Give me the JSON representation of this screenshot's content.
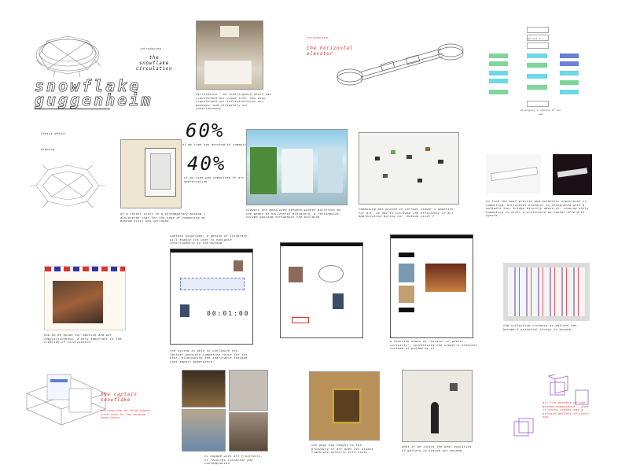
{
  "header": {
    "introducing_1": "introducing",
    "snowflake_circulation": "the snowflake circulation",
    "introducing_2": "introducing",
    "horizontal_elevator": "the horizontal elevator"
  },
  "title": {
    "line1": "snowflake",
    "line2": "guggenheim",
    "detail1": "thesis detail",
    "detail2": "drawing"
  },
  "stats": {
    "pct1": "60%",
    "cap1": "of my time was devoted to commuting",
    "pct2": "40%",
    "cap2": "of my time was committed to art appreciation"
  },
  "captions": {
    "circulation": "circulation - an intelligence which has transformed our urban life. has also transformed our infrastructures our museums. and ultimately our consciousness",
    "kiosk": "on a recent visit to a contemporary museum i discovered that for the sake of commuting my museum visit was shrinked",
    "atrium": "viewers are mobilized between pocket galleries by the means of horizontal elevators, a rectangular volume passing throughout the building",
    "gallery": "commuting has proved to corrupt viewer's appetite for art. so how to increase the efficiency in art appreciation during our 'museum visit'?",
    "elevator": "to find the most precise and authentic experience in commuting. horizontal elevator is integrated with a walkable tour bridge directly above it. viewing while commuting is still a preference we cannot afford to ignore.",
    "captain_intro": "captain snowflake, a genius of itinerary, will enable its user to navigate intelligently in the museum",
    "postcard": "how do we guide our emotion and our inquisitiveness, a very important in the creation of civilisation",
    "configure": "the system is able to configure the fastest possible commuting route for its user. eliminating the inevitable fatigue that impair experience",
    "timer": "00:01:00",
    "synthesis": "a function known as 'curator-of-poetic-curiosity', synthesizes the viewer's interest instead of guided by it",
    "book": "the collective richness of gallery has become a potential threat to museum",
    "captain_title": "the captain snowflake",
    "captain_sub": "introducing an intelligent interface to the museum experience",
    "engage": "to engage with art fruitfully, it requires isolation and contemplation",
    "vangogh": "van gogh has taught us the proximity of art does not always translate directly into scale",
    "whatif": "what if we invite the best qualities of gallery to inside our museum",
    "diagram": "all the pockets of the museum experience...what if every viewer has a private gallery of their own"
  },
  "flow": {
    "rows": [
      "mm out 1",
      "mm out 2",
      "mm out 3",
      "mm out 4",
      "mm out 5",
      "mm out 6"
    ],
    "footer": "diverging a choice of our own"
  },
  "colors": {
    "accent": "#e03030",
    "green": "#7fd69a",
    "cyan": "#6fd8e8",
    "blue": "#6a7fd8",
    "purple": "#9b5fd0"
  }
}
